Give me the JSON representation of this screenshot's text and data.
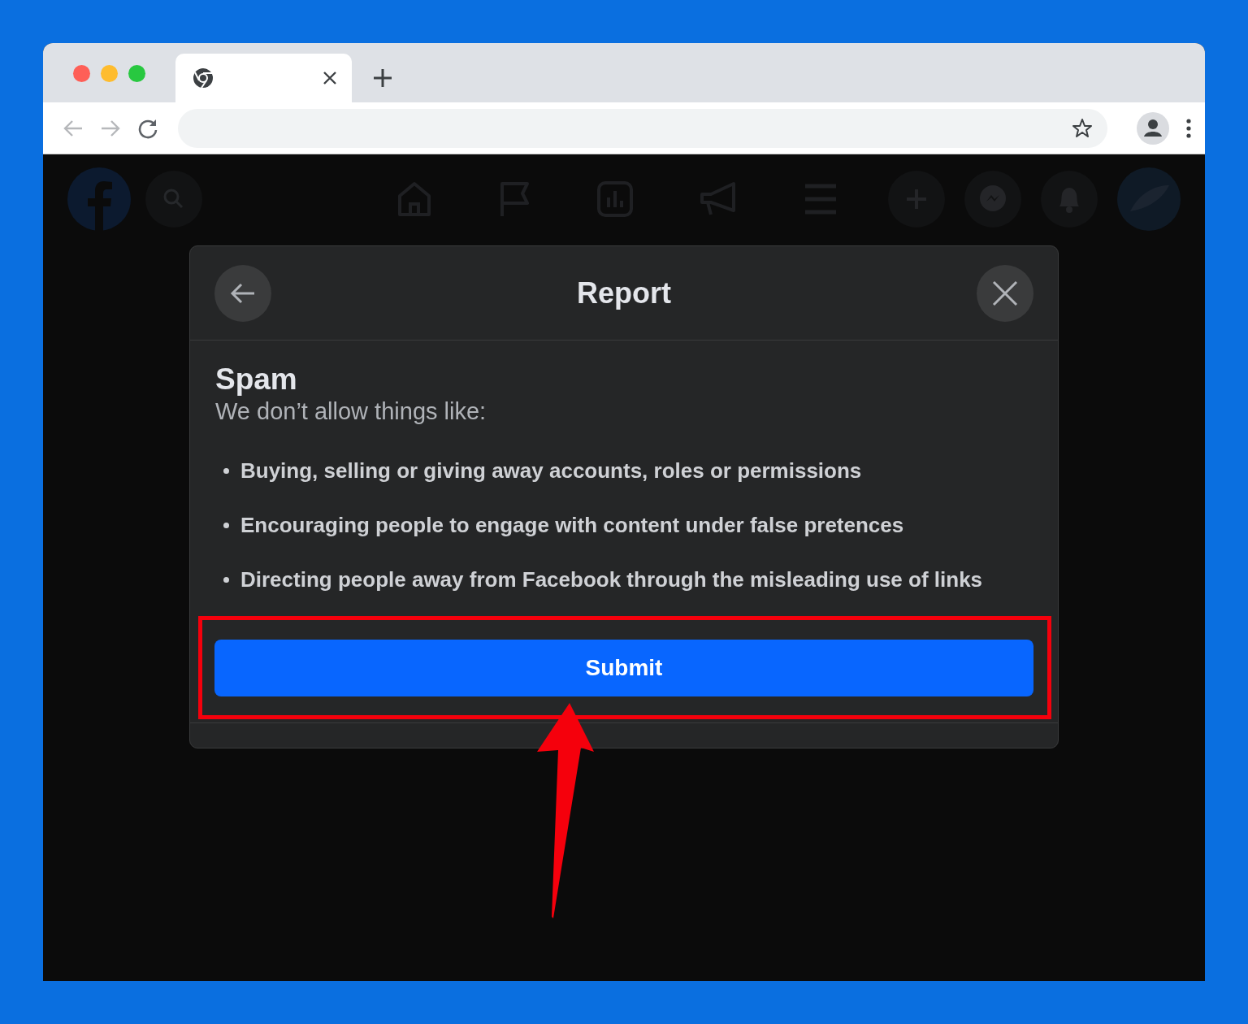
{
  "dialog": {
    "title": "Report",
    "heading": "Spam",
    "subtitle": "We don’t allow things like:",
    "items": [
      "Buying, selling or giving away accounts, roles or permissions",
      "Encouraging people to engage with content under false pretences",
      "Directing people away from Facebook through the misleading use of links"
    ],
    "submit_button": "Submit"
  }
}
